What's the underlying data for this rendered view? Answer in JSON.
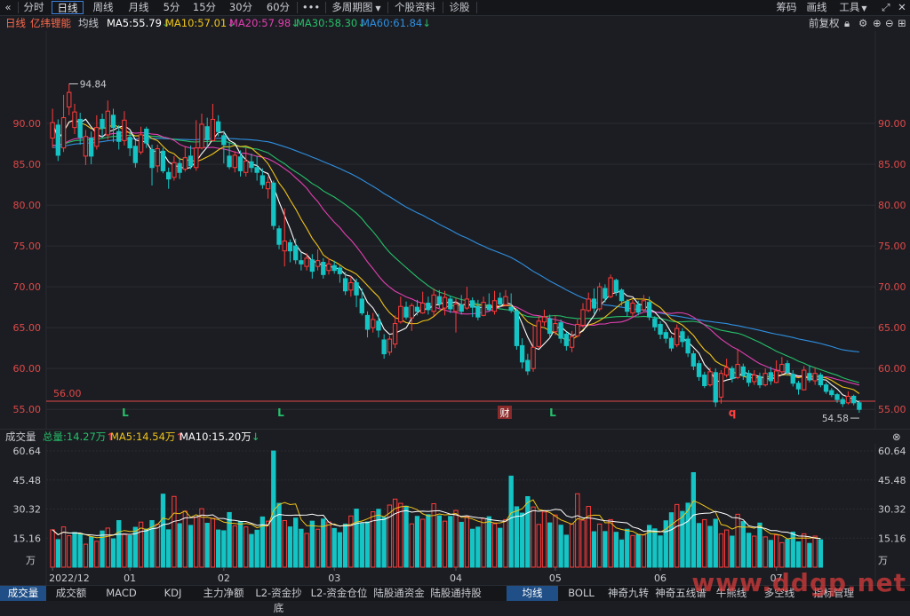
{
  "toolbar": {
    "back_icon": "double-chevron-left-icon",
    "periods": [
      "分时",
      "日线",
      "周线",
      "月线",
      "5分",
      "15分",
      "30分",
      "60分"
    ],
    "active_period": "日线",
    "more_label": "•••",
    "multi_label": "多周期图",
    "profile_label": "个股资料",
    "diag_label": "诊股",
    "chip_label": "筹码",
    "draw_label": "画线",
    "tools_label": "工具",
    "maximize_icon": "maximize-icon",
    "close_icon": "close-icon"
  },
  "indicator": {
    "period_label": "日线",
    "stock_name": "亿纬锂能",
    "ma_label": "均线",
    "ma5": "MA5:55.79",
    "ma10": "MA10:57.01",
    "ma20": "MA20:57.98",
    "ma30": "MA30:58.30",
    "ma60": "MA60:61.84",
    "adjust_label": "前复权",
    "colors": {
      "ma5": "#ffffff",
      "ma10": "#f0c419",
      "ma20": "#e23fb2",
      "ma30": "#25c06a",
      "ma60": "#2e8fe0"
    }
  },
  "volume_header": {
    "title": "成交量",
    "total": "总量:14.27万",
    "ma5": "MA5:14.54万",
    "ma10": "MA10:15.20万"
  },
  "bottom_tabs": [
    "成交量",
    "成交额",
    "MACD",
    "KDJ",
    "主力净额",
    "L2-资金抄底",
    "L2-资金仓位",
    "陆股通资金",
    "陆股通持股",
    "均线",
    "BOLL",
    "神奇九转",
    "神奇五线谱",
    "牛熊线",
    "多空线",
    "指标管理"
  ],
  "active_tabs": [
    "成交量",
    "均线"
  ],
  "watermark": "www.ddgp.net",
  "chart_data": [
    {
      "type": "candlestick",
      "y_ticks": [
        "90.00",
        "85.00",
        "80.00",
        "75.00",
        "70.00",
        "65.00",
        "60.00",
        "55.00"
      ],
      "ylim": [
        53.5,
        100
      ],
      "high_label": "94.84",
      "low_label": "54.58",
      "support_line": {
        "value": 56.0,
        "label": "56.00"
      },
      "markers": [
        {
          "x": 141,
          "label": "L",
          "color": "#25c06a"
        },
        {
          "x": 316,
          "label": "L",
          "color": "#25c06a"
        },
        {
          "x": 568,
          "label": "财",
          "color": "#ffffff"
        },
        {
          "x": 622,
          "label": "L",
          "color": "#25c06a"
        },
        {
          "x": 824,
          "label": "q",
          "color": "#ff4040"
        }
      ],
      "candles": [
        [
          88.2,
          90.1,
          91.8,
          87.0
        ],
        [
          89.8,
          86.1,
          90.5,
          85.4
        ],
        [
          87.0,
          90.7,
          93.5,
          86.5
        ],
        [
          92.0,
          93.8,
          94.84,
          91.0
        ],
        [
          89.5,
          91.4,
          92.4,
          88.7
        ],
        [
          90.5,
          88.3,
          91.3,
          87.4
        ],
        [
          86.0,
          88.4,
          89.2,
          84.9
        ],
        [
          88.2,
          86.0,
          89.0,
          85.0
        ],
        [
          87.2,
          89.5,
          91.0,
          86.8
        ],
        [
          90.5,
          89.4,
          91.2,
          88.3
        ],
        [
          88.6,
          91.5,
          92.8,
          88.0
        ],
        [
          91.0,
          89.5,
          91.8,
          87.7
        ],
        [
          89.0,
          87.8,
          89.8,
          86.8
        ],
        [
          87.9,
          90.4,
          91.5,
          87.3
        ],
        [
          88.3,
          87.0,
          89.0,
          86.0
        ],
        [
          87.2,
          85.2,
          87.9,
          84.6
        ],
        [
          86.5,
          88.6,
          89.6,
          86.2
        ],
        [
          89.3,
          87.6,
          89.6,
          87.0
        ],
        [
          86.8,
          84.6,
          87.4,
          82.4
        ],
        [
          84.8,
          86.9,
          87.4,
          84.0
        ],
        [
          86.6,
          84.2,
          87.0,
          83.9
        ],
        [
          84.0,
          83.2,
          84.6,
          82.0
        ],
        [
          83.4,
          85.2,
          86.0,
          83.0
        ],
        [
          85.1,
          84.0,
          85.8,
          83.2
        ],
        [
          84.4,
          85.8,
          87.2,
          84.1
        ],
        [
          86.0,
          84.8,
          87.3,
          84.4
        ],
        [
          84.6,
          87.0,
          90.4,
          84.2
        ],
        [
          87.0,
          89.9,
          91.2,
          86.8
        ],
        [
          89.6,
          88.0,
          90.7,
          87.0
        ],
        [
          87.9,
          90.5,
          92.4,
          87.8
        ],
        [
          90.2,
          89.0,
          91.0,
          88.4
        ],
        [
          88.5,
          87.4,
          89.1,
          85.1
        ],
        [
          86.0,
          84.7,
          87.7,
          84.4
        ],
        [
          84.6,
          86.1,
          86.6,
          84.0
        ],
        [
          85.9,
          84.2,
          86.7,
          83.5
        ],
        [
          84.0,
          85.4,
          87.0,
          83.5
        ],
        [
          85.3,
          84.6,
          86.3,
          84.0
        ],
        [
          84.6,
          84.0,
          86.0,
          83.0
        ],
        [
          83.6,
          82.5,
          84.5,
          82.0
        ],
        [
          82.0,
          82.8,
          83.5,
          80.8
        ],
        [
          82.7,
          77.5,
          83.0,
          77.0
        ],
        [
          77.1,
          75.2,
          77.5,
          74.6
        ],
        [
          74.4,
          75.6,
          79.6,
          72.5
        ],
        [
          75.4,
          74.4,
          75.8,
          73.0
        ],
        [
          75.0,
          73.3,
          75.9,
          72.8
        ],
        [
          73.2,
          72.8,
          74.2,
          72.0
        ],
        [
          72.5,
          73.5,
          74.1,
          72.0
        ],
        [
          73.3,
          71.9,
          74.0,
          71.0
        ],
        [
          72.5,
          73.2,
          74.6,
          72.0
        ],
        [
          73.0,
          71.5,
          73.5,
          71.0
        ],
        [
          72.0,
          72.8,
          73.5,
          71.5
        ],
        [
          72.6,
          72.0,
          73.2,
          71.6
        ],
        [
          72.3,
          71.6,
          72.6,
          70.5
        ],
        [
          71.0,
          69.5,
          71.8,
          69.0
        ],
        [
          69.6,
          70.5,
          71.3,
          68.8
        ],
        [
          70.5,
          69.0,
          71.0,
          67.5
        ],
        [
          68.5,
          66.8,
          69.8,
          66.5
        ],
        [
          66.5,
          64.8,
          67.0,
          63.8
        ],
        [
          65.0,
          66.0,
          66.8,
          64.4
        ],
        [
          65.8,
          64.7,
          66.7,
          63.8
        ],
        [
          63.5,
          61.8,
          64.2,
          61.2
        ],
        [
          62.0,
          63.6,
          64.0,
          61.6
        ],
        [
          63.0,
          65.5,
          66.5,
          62.5
        ],
        [
          65.7,
          67.6,
          68.8,
          65.5
        ],
        [
          67.5,
          66.3,
          68.2,
          66.0
        ],
        [
          66.2,
          67.7,
          68.0,
          64.6
        ],
        [
          67.5,
          67.0,
          68.4,
          66.5
        ],
        [
          66.8,
          68.0,
          69.4,
          66.7
        ],
        [
          68.0,
          67.2,
          68.8,
          66.6
        ],
        [
          67.0,
          69.0,
          69.8,
          66.4
        ],
        [
          68.8,
          67.9,
          69.6,
          67.4
        ],
        [
          67.4,
          68.7,
          69.5,
          66.5
        ],
        [
          68.5,
          67.3,
          68.9,
          66.8
        ],
        [
          67.0,
          67.9,
          68.6,
          64.4
        ],
        [
          67.8,
          67.0,
          69.0,
          66.6
        ],
        [
          67.4,
          68.5,
          70.0,
          67.2
        ],
        [
          68.3,
          67.5,
          68.7,
          66.3
        ],
        [
          67.6,
          66.3,
          68.4,
          65.9
        ],
        [
          66.5,
          68.1,
          68.8,
          66.4
        ],
        [
          67.8,
          67.2,
          69.2,
          67.0
        ],
        [
          67.0,
          68.3,
          69.5,
          66.6
        ],
        [
          68.6,
          67.9,
          69.3,
          67.5
        ],
        [
          67.8,
          68.8,
          69.6,
          67.6
        ],
        [
          67.5,
          67.1,
          69.2,
          66.8
        ],
        [
          67.0,
          62.8,
          67.3,
          62.3
        ],
        [
          62.8,
          60.8,
          63.7,
          60.0
        ],
        [
          61.0,
          59.7,
          61.8,
          59.2
        ],
        [
          60.0,
          62.6,
          65.3,
          59.6
        ],
        [
          62.7,
          65.8,
          66.4,
          62.5
        ],
        [
          65.7,
          66.3,
          67.2,
          65.2
        ],
        [
          66.1,
          64.3,
          66.6,
          63.8
        ],
        [
          64.5,
          65.5,
          66.5,
          64.1
        ],
        [
          65.6,
          63.7,
          66.0,
          63.1
        ],
        [
          64.2,
          62.8,
          64.5,
          62.2
        ],
        [
          62.6,
          63.9,
          64.6,
          62.0
        ],
        [
          64.0,
          65.4,
          66.0,
          63.8
        ],
        [
          65.3,
          67.2,
          68.0,
          65.0
        ],
        [
          67.1,
          68.5,
          69.3,
          66.9
        ],
        [
          68.5,
          67.4,
          69.8,
          66.7
        ],
        [
          67.3,
          70.0,
          70.5,
          67.0
        ],
        [
          69.8,
          68.6,
          70.3,
          68.1
        ],
        [
          68.8,
          71.1,
          71.5,
          68.6
        ],
        [
          70.8,
          69.4,
          71.0,
          68.9
        ],
        [
          69.6,
          68.3,
          69.8,
          67.7
        ],
        [
          68.2,
          67.0,
          68.5,
          66.4
        ],
        [
          66.8,
          68.0,
          68.4,
          66.3
        ],
        [
          67.8,
          66.9,
          68.3,
          66.5
        ],
        [
          67.2,
          68.3,
          69.0,
          66.9
        ],
        [
          68.1,
          66.3,
          68.8,
          65.9
        ],
        [
          66.1,
          65.1,
          66.4,
          64.6
        ],
        [
          65.4,
          64.2,
          65.8,
          63.6
        ],
        [
          64.4,
          63.7,
          64.8,
          63.1
        ],
        [
          63.7,
          62.5,
          64.0,
          62.1
        ],
        [
          62.9,
          64.9,
          65.4,
          62.6
        ],
        [
          64.5,
          63.3,
          64.9,
          62.6
        ],
        [
          63.6,
          61.9,
          64.0,
          61.4
        ],
        [
          61.8,
          60.3,
          62.2,
          59.8
        ],
        [
          60.6,
          59.0,
          61.0,
          58.5
        ],
        [
          59.2,
          57.9,
          59.6,
          57.6
        ],
        [
          58.0,
          59.6,
          60.1,
          57.8
        ],
        [
          59.5,
          55.9,
          60.0,
          55.3
        ],
        [
          56.5,
          59.4,
          59.8,
          55.7
        ],
        [
          59.2,
          60.1,
          61.2,
          58.9
        ],
        [
          60.0,
          58.8,
          60.3,
          58.3
        ],
        [
          58.9,
          60.5,
          62.3,
          58.7
        ],
        [
          60.2,
          59.1,
          60.6,
          58.6
        ],
        [
          59.4,
          58.3,
          59.8,
          57.8
        ],
        [
          58.4,
          59.2,
          59.8,
          58.0
        ],
        [
          59.0,
          58.0,
          59.5,
          57.6
        ],
        [
          58.0,
          59.4,
          60.0,
          57.8
        ],
        [
          59.5,
          58.5,
          60.2,
          58.0
        ],
        [
          58.3,
          59.7,
          61.0,
          58.2
        ],
        [
          59.6,
          60.5,
          61.4,
          59.3
        ],
        [
          60.6,
          59.5,
          61.0,
          59.1
        ],
        [
          59.3,
          58.2,
          59.8,
          57.8
        ],
        [
          58.2,
          57.5,
          58.5,
          56.8
        ],
        [
          57.4,
          59.8,
          60.3,
          57.3
        ],
        [
          59.4,
          58.6,
          60.4,
          58.3
        ],
        [
          58.5,
          59.4,
          60.1,
          58.0
        ],
        [
          59.2,
          58.0,
          59.5,
          57.7
        ],
        [
          58.0,
          57.2,
          58.3,
          56.9
        ],
        [
          57.3,
          56.8,
          57.6,
          56.5
        ],
        [
          56.8,
          56.2,
          57.0,
          55.8
        ],
        [
          56.2,
          55.7,
          56.5,
          55.3
        ],
        [
          55.8,
          56.6,
          57.2,
          55.6
        ],
        [
          56.6,
          55.8,
          56.8,
          55.5
        ],
        [
          55.8,
          55.0,
          56.1,
          54.58
        ]
      ]
    },
    {
      "type": "bar",
      "title": "成交量",
      "unit": "万",
      "y_ticks": [
        "60.64",
        "45.48",
        "30.32",
        "15.16"
      ],
      "ylim": [
        0,
        60.64
      ],
      "x_labels": [
        {
          "text": "2022/12",
          "index": 0
        },
        {
          "text": "01",
          "index": 14
        },
        {
          "text": "02",
          "index": 31
        },
        {
          "text": "03",
          "index": 51
        },
        {
          "text": "04",
          "index": 73
        },
        {
          "text": "05",
          "index": 91
        },
        {
          "text": "06",
          "index": 110
        },
        {
          "text": "07",
          "index": 131
        }
      ],
      "volumes": [
        19.5,
        14.4,
        21.0,
        16.4,
        18.1,
        17.5,
        12.0,
        15.8,
        13.5,
        18.9,
        20.4,
        14.8,
        24.3,
        17.3,
        16.4,
        20.8,
        23.5,
        19.9,
        24.3,
        22.4,
        38.1,
        19.5,
        36.9,
        22.7,
        29.2,
        21.8,
        26.1,
        30.5,
        22.9,
        25.5,
        19.4,
        19.0,
        28.5,
        21.6,
        23.7,
        21.0,
        17.1,
        19.3,
        26.2,
        24.0,
        60.6,
        33.3,
        24.3,
        21.0,
        25.6,
        19.8,
        17.6,
        24.0,
        19.8,
        25.1,
        23.6,
        20.2,
        18.0,
        22.5,
        26.7,
        30.3,
        22.8,
        23.6,
        28.9,
        30.2,
        26.0,
        32.4,
        35.5,
        33.3,
        31.8,
        22.6,
        26.5,
        25.0,
        27.4,
        33.1,
        26.8,
        24.0,
        26.5,
        29.6,
        23.4,
        26.3,
        19.8,
        20.9,
        25.4,
        26.3,
        22.7,
        20.3,
        24.8,
        47.5,
        31.5,
        28.2,
        36.8,
        31.4,
        22.3,
        28.8,
        23.1,
        27.2,
        21.9,
        16.7,
        22.6,
        38.3,
        24.5,
        31.7,
        18.5,
        22.5,
        18.6,
        24.8,
        18.2,
        14.2,
        19.8,
        16.5,
        17.0,
        16.8,
        21.8,
        20.0,
        16.3,
        24.2,
        28.4,
        32.7,
        29.1,
        33.4,
        49.3,
        22.8,
        24.8,
        21.3,
        25.0,
        17.4,
        19.4,
        16.2,
        27.6,
        23.8,
        17.7,
        16.2,
        23.0,
        15.8,
        14.0,
        16.8,
        12.8,
        14.5,
        18.3,
        13.2,
        17.4,
        12.4,
        16.2,
        14.3
      ],
      "up_flags": [
        1,
        0,
        1,
        1,
        0,
        0,
        1,
        0,
        1,
        0,
        1,
        0,
        0,
        1,
        0,
        0,
        1,
        0,
        0,
        1,
        0,
        0,
        1,
        0,
        1,
        0,
        1,
        1,
        0,
        1,
        0,
        0,
        0,
        1,
        0,
        1,
        0,
        0,
        0,
        1,
        0,
        0,
        1,
        0,
        0,
        0,
        1,
        0,
        1,
        0,
        1,
        0,
        0,
        0,
        1,
        0,
        0,
        0,
        1,
        0,
        0,
        1,
        1,
        1,
        0,
        1,
        0,
        1,
        0,
        1,
        0,
        1,
        0,
        1,
        0,
        1,
        0,
        0,
        1,
        0,
        1,
        0,
        1,
        0,
        0,
        0,
        0,
        1,
        1,
        1,
        0,
        1,
        0,
        0,
        1,
        1,
        1,
        1,
        0,
        1,
        0,
        1,
        0,
        0,
        0,
        1,
        0,
        1,
        0,
        0,
        0,
        0,
        0,
        1,
        0,
        0,
        0,
        0,
        1,
        0,
        0,
        1,
        1,
        0,
        1,
        0,
        0,
        1,
        0,
        1,
        0,
        1,
        1,
        0,
        0,
        0,
        1,
        0,
        1,
        0,
        0,
        0,
        0,
        1,
        0,
        0
      ]
    }
  ]
}
